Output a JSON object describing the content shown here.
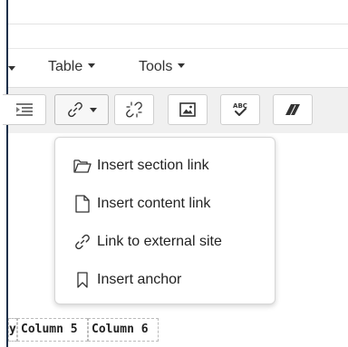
{
  "menubar": {
    "items": [
      {
        "label": "Table"
      },
      {
        "label": "Tools"
      }
    ]
  },
  "toolbar": {
    "buttons": [
      "indent-icon",
      "link-icon",
      "unlink-icon",
      "image-icon",
      "spellcheck-icon",
      "eraser-icon"
    ]
  },
  "dropdown": {
    "items": [
      {
        "label": "Insert section link",
        "icon": "folder-open-icon"
      },
      {
        "label": "Insert content link",
        "icon": "file-icon"
      },
      {
        "label": "Link to external site",
        "icon": "link-icon"
      },
      {
        "label": "Insert anchor",
        "icon": "bookmark-icon"
      }
    ]
  },
  "table": {
    "partial_header": "y",
    "headers": [
      "Column 5",
      "Column 6"
    ]
  },
  "colors": {
    "border_dark": "#1a2f4a",
    "toolbar_bg": "#f0f0f0",
    "button_border": "#cfcfcf"
  }
}
